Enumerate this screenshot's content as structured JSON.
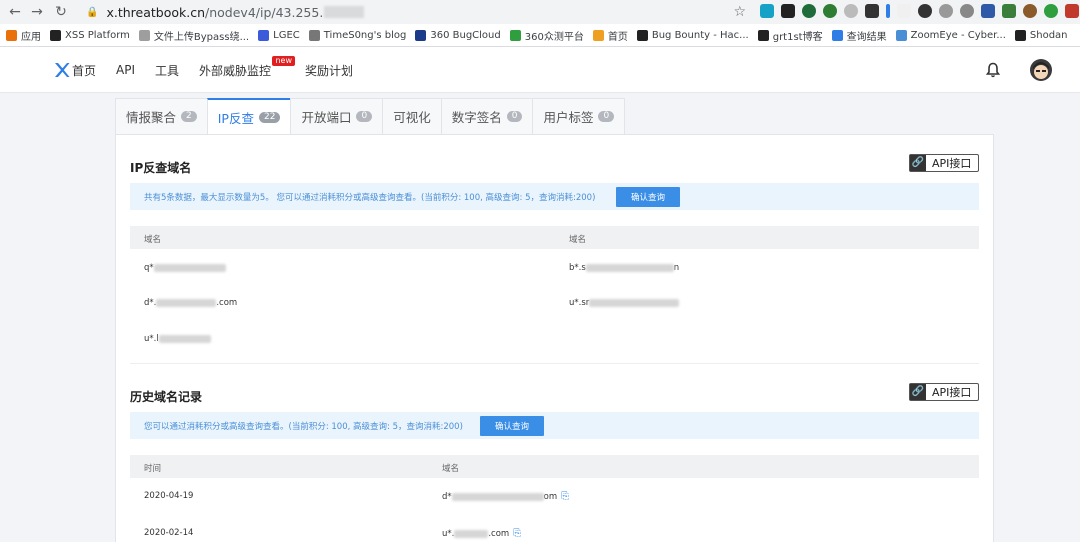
{
  "browser": {
    "url_host": "x.threatbook.cn",
    "url_path": "/nodev4/ip/43.255.",
    "bookmarks": [
      {
        "label": "应用",
        "icon": "apps-icon",
        "color": "#e8710a"
      },
      {
        "label": "XSS Platform",
        "icon": "x-icon",
        "color": "#222222"
      },
      {
        "label": "文件上传Bypass绕...",
        "icon": "diamond-icon",
        "color": "#9e9e9e"
      },
      {
        "label": "LGEC",
        "icon": "lgec-icon",
        "color": "#3b5bdb"
      },
      {
        "label": "TimeS0ng's blog",
        "icon": "page-icon",
        "color": "#777777"
      },
      {
        "label": "360 BugCloud",
        "icon": "triangle-icon",
        "color": "#1b3b8a"
      },
      {
        "label": "360众测平台",
        "icon": "circle-icon",
        "color": "#2e9e3e"
      },
      {
        "label": "首页",
        "icon": "flame-icon",
        "color": "#f0a020"
      },
      {
        "label": "Bug Bounty - Hac...",
        "icon": "h-icon",
        "color": "#222222"
      },
      {
        "label": "grt1st博客",
        "icon": "github-icon",
        "color": "#222222"
      },
      {
        "label": "查询结果",
        "icon": "x-logo-icon",
        "color": "#2f7ee6"
      },
      {
        "label": "ZoomEye - Cyber...",
        "icon": "eye-icon",
        "color": "#4a8fd6"
      },
      {
        "label": "Shodan",
        "icon": "globe-icon",
        "color": "#222222"
      }
    ]
  },
  "header": {
    "nav": [
      {
        "label": "首页"
      },
      {
        "label": "API"
      },
      {
        "label": "工具"
      },
      {
        "label": "外部威胁监控",
        "badge": "new"
      },
      {
        "label": "奖励计划"
      }
    ]
  },
  "tabs": [
    {
      "label": "情报聚合",
      "count": "2",
      "active": false
    },
    {
      "label": "IP反查",
      "count": "22",
      "active": true
    },
    {
      "label": "开放端口",
      "count": "0",
      "active": false
    },
    {
      "label": "可视化",
      "count": "",
      "active": false
    },
    {
      "label": "数字签名",
      "count": "0",
      "active": false
    },
    {
      "label": "用户标签",
      "count": "0",
      "active": false
    }
  ],
  "reverse_section": {
    "title": "IP反查域名",
    "api_label": "API接口",
    "notice": "共有5条数据，最大显示数量为5。 您可以通过消耗积分或高级查询查看。(当前积分: 100, 高级查询: 5，查询消耗:200)",
    "confirm_label": "确认查询",
    "column_header": "域名",
    "column_header_right": "域名",
    "domains": [
      {
        "prefix": "q*",
        "suffix": ""
      },
      {
        "prefix": "b*.s",
        "suffix": "n"
      },
      {
        "prefix": "d*.",
        "suffix": ".com"
      },
      {
        "prefix": "u*.sr",
        "suffix": ""
      },
      {
        "prefix": "u*.l",
        "suffix": ""
      }
    ]
  },
  "history_section": {
    "title": "历史域名记录",
    "api_label": "API接口",
    "notice": "您可以通过消耗积分或高级查询查看。(当前积分: 100, 高级查询: 5，查询消耗:200)",
    "confirm_label": "确认查询",
    "col_time": "时间",
    "col_domain": "域名",
    "rows": [
      {
        "date": "2020-04-19",
        "prefix": "d*",
        "suffix": "om"
      },
      {
        "date": "2020-02-14",
        "prefix": "u*.",
        "suffix": ".com"
      }
    ]
  }
}
